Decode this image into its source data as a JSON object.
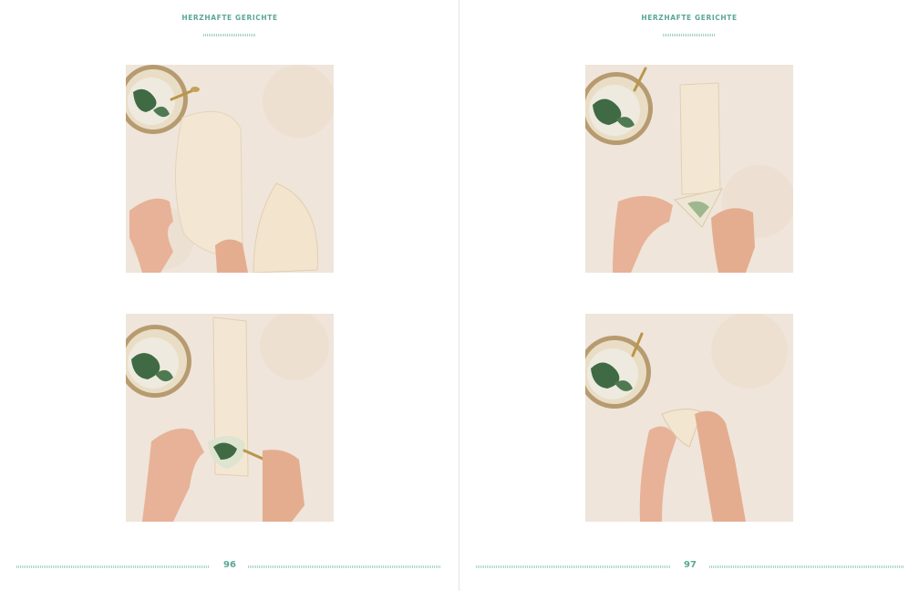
{
  "left_page": {
    "running_head": "HERZHAFTE GERICHTE",
    "page_number": "96",
    "photos": [
      {
        "icon": "filo-sheet-cutting-photo"
      },
      {
        "icon": "filling-spooned-on-strip-photo"
      }
    ]
  },
  "right_page": {
    "running_head": "HERZHAFTE GERICHTE",
    "page_number": "97",
    "photos": [
      {
        "icon": "triangle-folding-start-photo"
      },
      {
        "icon": "triangle-folding-finish-photo"
      }
    ]
  },
  "colors": {
    "accent": "#5aa796",
    "rule": "#a6d4ca",
    "surface": "#efe5db",
    "filo": "#f3e7d3",
    "skin": "#e7b297",
    "spinach": "#3f6a44"
  }
}
